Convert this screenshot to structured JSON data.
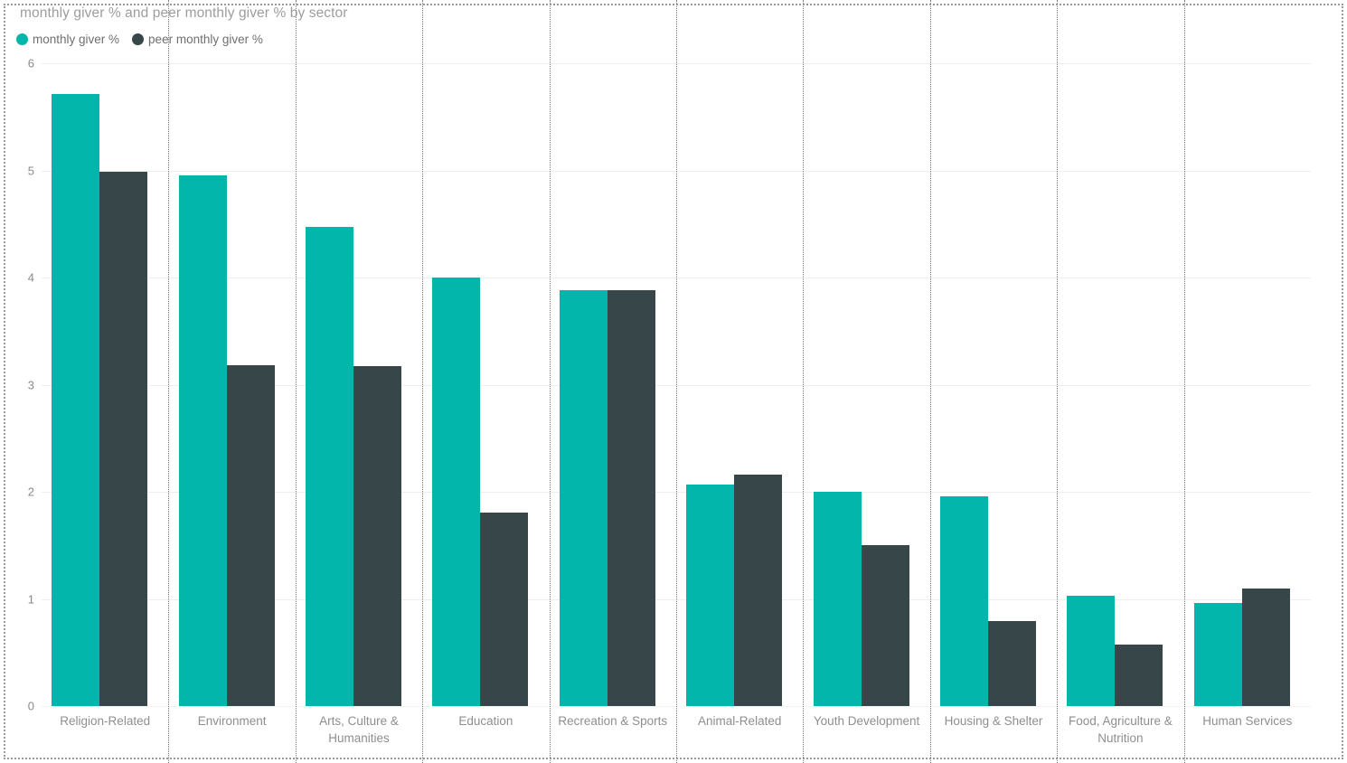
{
  "header": {
    "title": "monthly giver % and peer monthly giver % by sector"
  },
  "legend": {
    "items": [
      {
        "label": "monthly giver %",
        "color": "#03b6ac",
        "icon": "circle-marker-icon"
      },
      {
        "label": "peer monthly giver %",
        "color": "#374649",
        "icon": "circle-marker-icon"
      }
    ]
  },
  "axis": {
    "y_ticks": [
      "0",
      "1",
      "2",
      "3",
      "4",
      "5",
      "6"
    ]
  },
  "chart_data": {
    "type": "bar",
    "title": "monthly giver % and peer monthly giver % by sector",
    "xlabel": "",
    "ylabel": "",
    "ylim": [
      0,
      6
    ],
    "yticks": [
      0,
      1,
      2,
      3,
      4,
      5,
      6
    ],
    "grid": true,
    "legend_position": "top-left",
    "categories": [
      "Religion-Related",
      "Environment",
      "Arts, Culture & Humanities",
      "Education",
      "Recreation & Sports",
      "Animal-Related",
      "Youth Development",
      "Housing & Shelter",
      "Food, Agriculture & Nutrition",
      "Human Services"
    ],
    "series": [
      {
        "name": "monthly giver %",
        "color": "#03b6ac",
        "values": [
          5.71,
          4.95,
          4.47,
          4.0,
          3.88,
          2.07,
          2.0,
          1.96,
          1.03,
          0.96
        ]
      },
      {
        "name": "peer monthly giver %",
        "color": "#374649",
        "values": [
          4.99,
          3.18,
          3.17,
          1.81,
          3.88,
          2.16,
          1.5,
          0.79,
          0.57,
          1.1
        ]
      }
    ]
  }
}
